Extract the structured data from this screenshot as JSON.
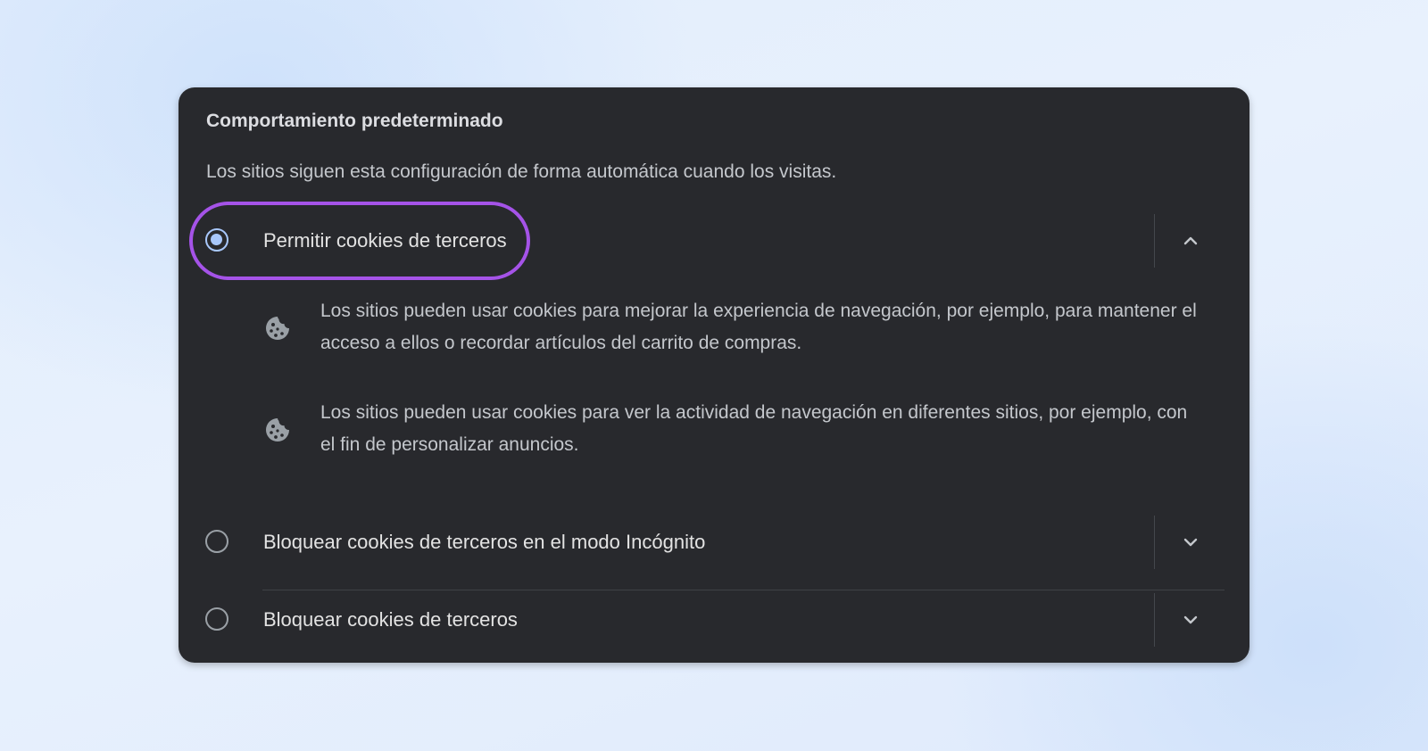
{
  "section": {
    "title": "Comportamiento predeterminado",
    "description": "Los sitios siguen esta configuración de forma automática cuando los visitas."
  },
  "options": [
    {
      "label": "Permitir cookies de terceros",
      "selected": true,
      "expanded": true,
      "chevron_icon": "chevron-up-icon",
      "details": [
        {
          "icon": "cookie-icon",
          "text": "Los sitios pueden usar cookies para mejorar la experiencia de navegación, por ejemplo, para mantener el acceso a ellos o recordar artículos del carrito de compras."
        },
        {
          "icon": "cookie-icon",
          "text": "Los sitios pueden usar cookies para ver la actividad de navegación en diferentes sitios, por ejemplo, con el fin de personalizar anuncios."
        }
      ]
    },
    {
      "label": "Bloquear cookies de terceros en el modo Incógnito",
      "selected": false,
      "expanded": false,
      "chevron_icon": "chevron-down-icon"
    },
    {
      "label": "Bloquear cookies de terceros",
      "selected": false,
      "expanded": false,
      "chevron_icon": "chevron-down-icon"
    }
  ],
  "colors": {
    "panel_background": "#28292d",
    "page_background": "#e3eefc",
    "accent_radio": "#a8c7fa",
    "highlight_ring": "#a553e8",
    "primary_text": "#e3e3e3",
    "secondary_text": "#c4c7cc"
  }
}
